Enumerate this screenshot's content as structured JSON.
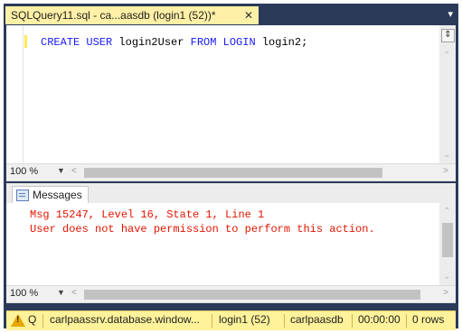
{
  "tab": {
    "title": "SQLQuery11.sql - ca...aasdb (login1 (52))*",
    "close": "✕",
    "menu": "▾"
  },
  "editor": {
    "code": {
      "kw1": "CREATE USER",
      "t1": " login2User ",
      "kw2": "FROM LOGIN",
      "t2": " login2;"
    }
  },
  "zoom": {
    "top": "100 %",
    "bottom": "100 %"
  },
  "messages": {
    "tab_label": "Messages",
    "lines": [
      "Msg 15247, Level 16, State 1, Line 1",
      "User does not have permission to perform this action."
    ]
  },
  "statusbar": {
    "q": "Q",
    "server": "carlpaassrv.database.window...",
    "login": "login1 (52)",
    "database": "carlpaasdb",
    "time": "00:00:00",
    "rows": "0 rows"
  },
  "colors": {
    "accent": "#2b3a59",
    "tab_active": "#fff0a7",
    "status": "#fff29a",
    "error": "#e51400",
    "keyword": "#1a1aff"
  },
  "icons": [
    "warning-icon",
    "messages-icon",
    "close-icon",
    "split-icon"
  ]
}
